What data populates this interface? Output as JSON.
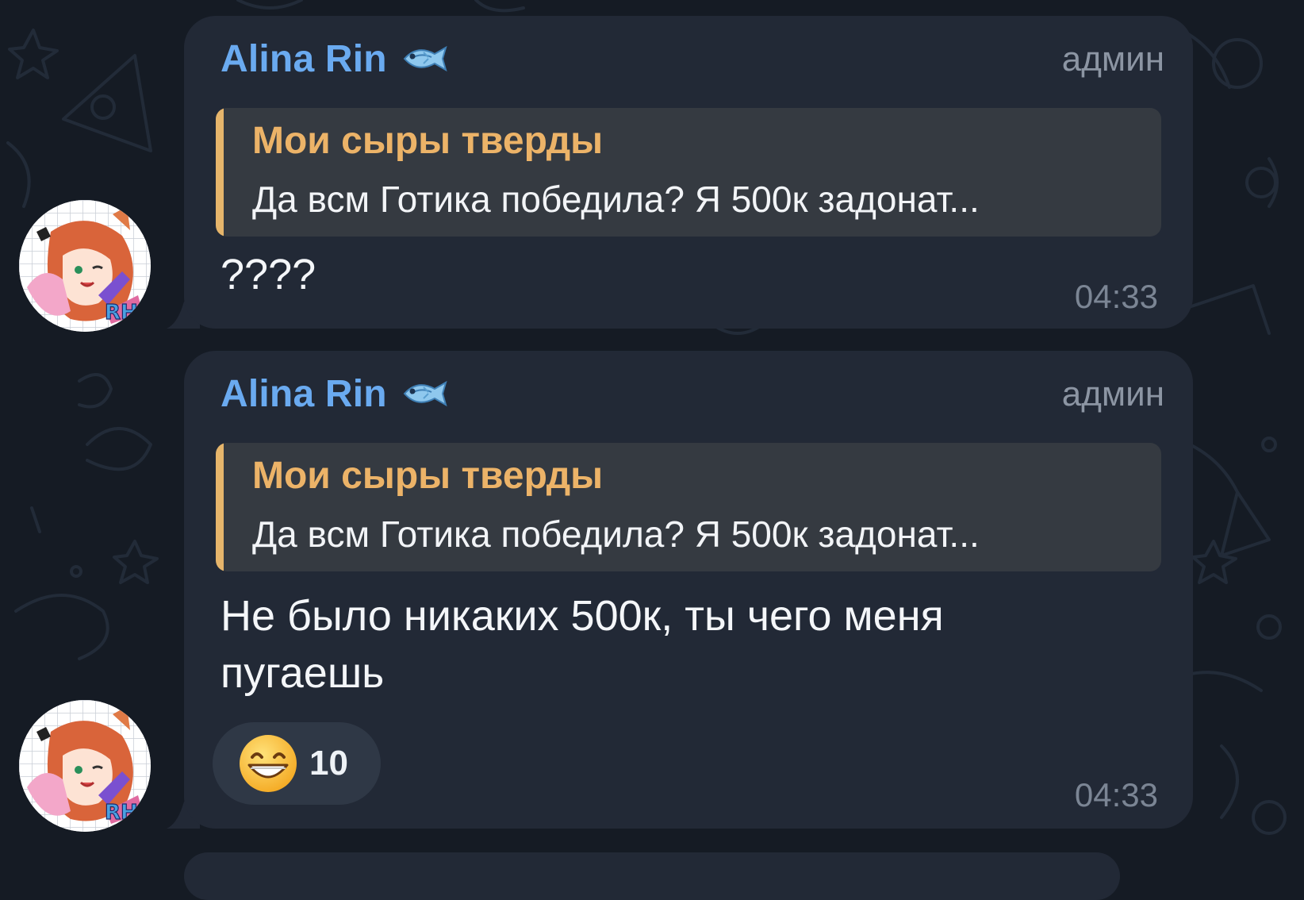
{
  "messages": [
    {
      "sender": "Alina Rin",
      "sender_icon": "fish-icon",
      "role": "админ",
      "reply": {
        "author": "Мои сыры тверды",
        "text": "Да всм Готика победила? Я 500к задонат..."
      },
      "text": "????",
      "time": "04:33"
    },
    {
      "sender": "Alina Rin",
      "sender_icon": "fish-icon",
      "role": "админ",
      "reply": {
        "author": "Мои сыры тверды",
        "text": "Да всм Готика победила? Я 500к задонат..."
      },
      "text_lines": [
        "Не было никаких 500к, ты чего меня",
        "пугаешь"
      ],
      "reaction": {
        "emoji": "grinning-face-emoji",
        "count": "10"
      },
      "time": "04:33"
    }
  ],
  "colors": {
    "background": "#151b24",
    "bubble": "#222936",
    "sender_name": "#6aaaf0",
    "quote_accent": "#e6b56b",
    "quote_background": "#353a41"
  }
}
